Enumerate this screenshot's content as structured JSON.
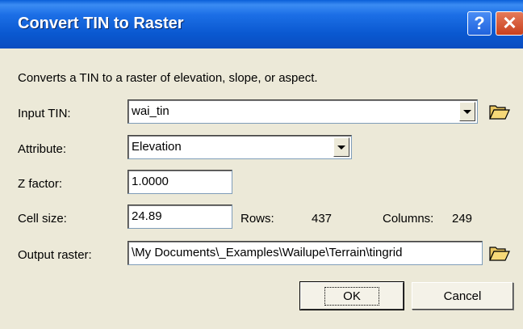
{
  "window": {
    "title": "Convert TIN to Raster",
    "help_glyph": "?",
    "close_glyph": "✕"
  },
  "description": "Converts a TIN to a raster of elevation, slope, or aspect.",
  "input_tin": {
    "label": "Input TIN:",
    "value": "wai_tin"
  },
  "attribute": {
    "label": "Attribute:",
    "value": "Elevation"
  },
  "z_factor": {
    "label": "Z factor:",
    "value": "1.0000"
  },
  "cell_size": {
    "label": "Cell size:",
    "value": "24.89",
    "rows_label": "Rows:",
    "rows_value": "437",
    "columns_label": "Columns:",
    "columns_value": "249"
  },
  "output_raster": {
    "label": "Output raster:",
    "value": "\\My Documents\\_Examples\\Wailupe\\Terrain\\tingrid"
  },
  "buttons": {
    "ok": "OK",
    "cancel": "Cancel"
  },
  "icons": {
    "browse": "folder-open-icon",
    "dropdown": "chevron-down-icon"
  }
}
